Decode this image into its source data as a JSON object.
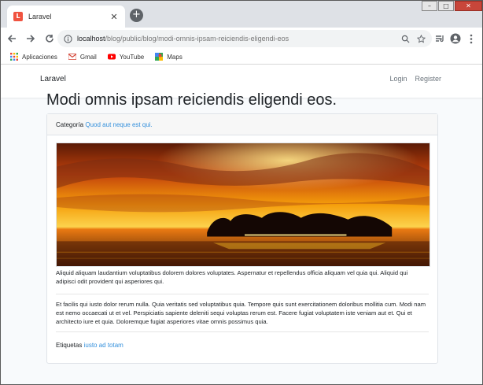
{
  "browser": {
    "tab_title": "Laravel",
    "url_host": "localhost",
    "url_path": "/blog/public/blog/modi-omnis-ipsam-reiciendis-eligendi-eos",
    "bookmarks": [
      {
        "label": "Aplicaciones",
        "icon": "apps-grid-icon"
      },
      {
        "label": "Gmail",
        "icon": "gmail-icon"
      },
      {
        "label": "YouTube",
        "icon": "youtube-icon"
      },
      {
        "label": "Maps",
        "icon": "maps-icon"
      }
    ]
  },
  "page": {
    "brand": "Laravel",
    "nav": {
      "login": "Login",
      "register": "Register"
    },
    "title": "Modi omnis ipsam reiciendis eligendi eos.",
    "category_label": "Categoría",
    "category_value": "Quod aut neque est qui.",
    "excerpt": "Aliquid aliquam laudantium voluptatibus dolorem dolores voluptates. Aspernatur et repellendus officia aliquam vel quia qui. Aliquid qui adipisci odit provident qui asperiores qui.",
    "body": "Et facilis qui iusto dolor rerum nulla. Quia veritatis sed voluptatibus quia. Tempore quis sunt exercitationem doloribus mollitia cum. Modi nam est nemo occaecati ut et vel. Perspiciatis sapiente deleniti sequi voluptas rerum est. Facere fugiat voluptatem iste veniam aut et. Qui et architecto iure et quia. Doloremque fugiat asperiores vitae omnis possimus quia.",
    "tags_label": "Etiquetas",
    "tags_value": "iusto ad totam"
  },
  "colors": {
    "link": "#3490dc",
    "text": "#212529",
    "page_bg": "#f8fafc"
  }
}
